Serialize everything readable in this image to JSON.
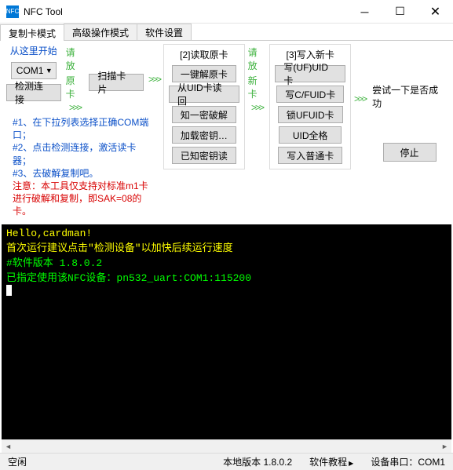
{
  "window": {
    "title": "NFC Tool",
    "icon_text": "NFC"
  },
  "tabs": {
    "t0": "复制卡模式",
    "t1": "高级操作模式",
    "t2": "软件设置"
  },
  "col1": {
    "title": "从这里开始",
    "combo_value": "COM1",
    "detect_btn": "检测连接"
  },
  "arrow1": {
    "label1": "请放",
    "label2": "原卡",
    "arrows": ">>>"
  },
  "scan_btn": "扫描卡片",
  "hints": {
    "l1": "#1、在下拉列表选择正确COM端口；",
    "l2": "#2、点击检测连接，激活读卡器；",
    "l3": "#3、去破解复制吧。",
    "warn": "注意：本工具仅支持对标准m1卡进行破解和复制，即SAK=08的卡。"
  },
  "read": {
    "title": "[2]读取原卡",
    "b1": "一键解原卡",
    "b2": "从UID卡读回",
    "b3": "知一密破解",
    "b4": "加载密钥…",
    "b5": "已知密钥读"
  },
  "arrow2": {
    "label1": "请放",
    "label2": "新卡",
    "arrows": ">>>"
  },
  "write": {
    "title": "[3]写入新卡",
    "b1": "写(UF)UID卡",
    "b2": "写C/FUID卡",
    "b3": "锁UFUID卡",
    "b4": "UID全格",
    "b5": "写入普通卡"
  },
  "arrow3": {
    "arrows": ">>>"
  },
  "right": {
    "try_label": "尝试一下是否成功",
    "stop": "停止"
  },
  "console": {
    "l1": "Hello,cardman!",
    "l2": "首次运行建议点击\"检测设备\"以加快后续运行速度",
    "l3": "#软件版本 1.8.0.2",
    "l4": "已指定使用该NFC设备：pn532_uart:COM1:115200"
  },
  "status": {
    "idle": "空闲",
    "version": "本地版本 1.8.0.2",
    "tutorial": "软件教程",
    "port": "设备串口：COM1"
  }
}
